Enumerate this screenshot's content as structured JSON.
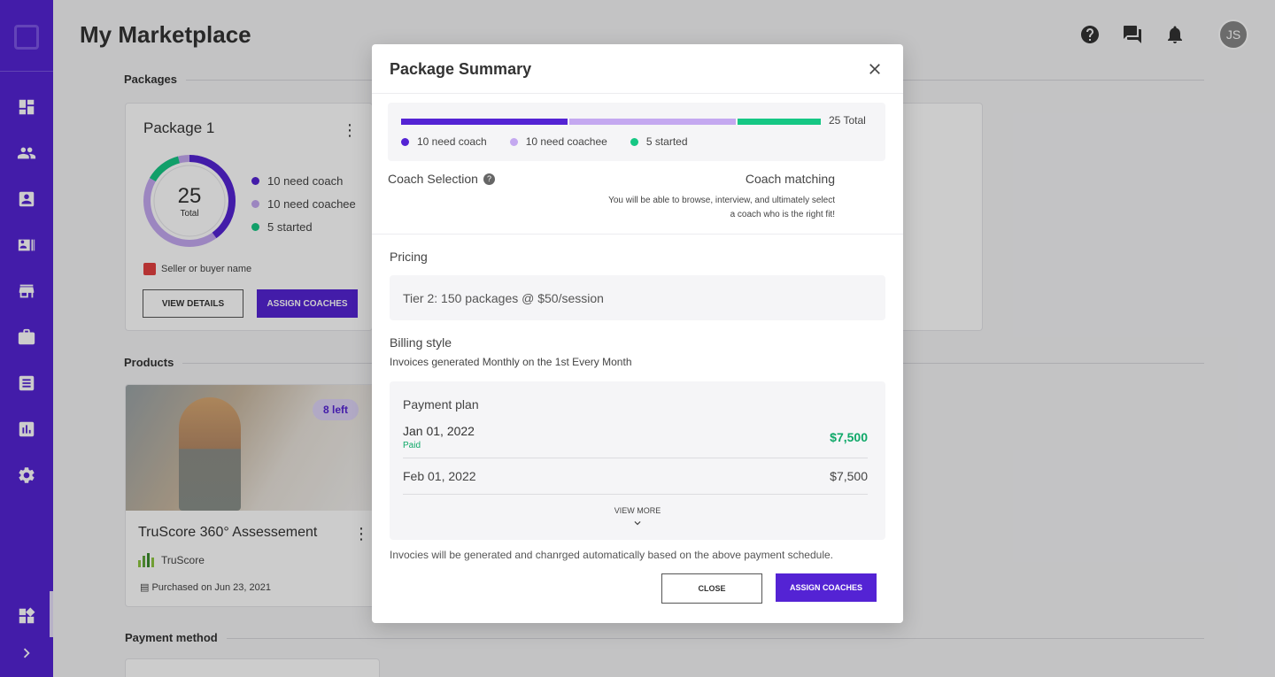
{
  "colors": {
    "brand": "#5423d4",
    "need_coach": "#5423d4",
    "need_coachee": "#c4a8f0",
    "started": "#16c784",
    "paid_green": "#0ea868"
  },
  "sidebar": {
    "items": [
      {
        "icon": "dashboard-icon"
      },
      {
        "icon": "people-icon"
      },
      {
        "icon": "contact-card-icon"
      },
      {
        "icon": "list-card-icon"
      },
      {
        "icon": "store-icon"
      },
      {
        "icon": "briefcase-icon"
      },
      {
        "icon": "document-icon"
      },
      {
        "icon": "analytics-icon"
      },
      {
        "icon": "settings-icon"
      }
    ],
    "bottom": [
      {
        "icon": "widgets-icon"
      },
      {
        "icon": "chevron-right-icon"
      }
    ]
  },
  "header": {
    "title": "My Marketplace",
    "avatar_initials": "JS"
  },
  "sections": {
    "packages": "Packages",
    "products": "Products",
    "payment_method": "Payment method"
  },
  "package_card": {
    "name": "Package 1",
    "total_num": "25",
    "total_label": "Total",
    "legend": [
      "10 need coach",
      "10 need coachee",
      "5 started"
    ],
    "seller": "Seller or buyer name",
    "view_details": "VIEW DETAILS",
    "assign_coaches": "ASSIGN COACHES"
  },
  "product_card": {
    "badge": "8 left",
    "title": "TruScore 360° Assessement",
    "vendor": "TruScore",
    "purchased": "Purchased on Jun 23, 2021"
  },
  "modal": {
    "title": "Package Summary",
    "progress": {
      "total": "25 Total",
      "segments": [
        {
          "label": "10 need coach",
          "value": 10
        },
        {
          "label": "10 need coachee",
          "value": 10
        },
        {
          "label": "5 started",
          "value": 5
        }
      ]
    },
    "coach_selection_label": "Coach Selection",
    "coach_selection_value": "Coach  matching",
    "coach_selection_desc": "You will be able to browse, interview, and ultimately select a coach who is the right fit!",
    "pricing_label": "Pricing",
    "pricing_value": "Tier 2: 150 packages @ $50/session",
    "billing_label": "Billing style",
    "billing_desc": "Invoices generated Monthly on the 1st  Every Month",
    "payment_plan": {
      "label": "Payment plan",
      "rows": [
        {
          "date": "Jan 01, 2022",
          "status": "Paid",
          "amount": "$7,500"
        },
        {
          "date": "Feb 01, 2022",
          "amount": "$7,500"
        }
      ],
      "view_more": "VIEW MORE"
    },
    "invoice_note": "Invocies will be generated and chanrged automatically based on the above payment schedule.",
    "close_button": "CLOSE",
    "assign_button": "ASSIGN COACHES"
  }
}
